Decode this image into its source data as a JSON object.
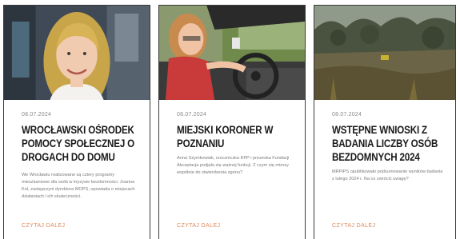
{
  "articles": [
    {
      "date": "08.07.2024",
      "title": "Wrocławski Ośrodek Pomocy Społecznej o drogach do domu",
      "excerpt": "We Wrocławiu realizowane są cztery programy mieszkaniowe dla osób w kryzysie bezdomności. Joanna Kol, zastępczyni dyrektora MOPS, opowiada o miejscach działaniach i ich skuteczności.",
      "read_more": "CZYTAJ DALEJ"
    },
    {
      "date": "08.07.2024",
      "title": "Miejski Koroner w Poznaniu",
      "excerpt": "Anna Szymkowiak, rzeczniczka KPP i prezeska Fundacji Akceptacja podjęła się ważnej funkcji. Z czym się mierzy wspólnie do stwierdzenia zgonu?",
      "read_more": "CZYTAJ DALEJ"
    },
    {
      "date": "08.07.2024",
      "title": "Wstępne wnioski z badania liczby osób bezdomnych 2024",
      "excerpt": "MRPiPS opublikowało podsumowanie wyników badania z lutego 2024 r. Na co zwrócić uwagę?",
      "read_more": "CZYTAJ DALEJ"
    }
  ]
}
